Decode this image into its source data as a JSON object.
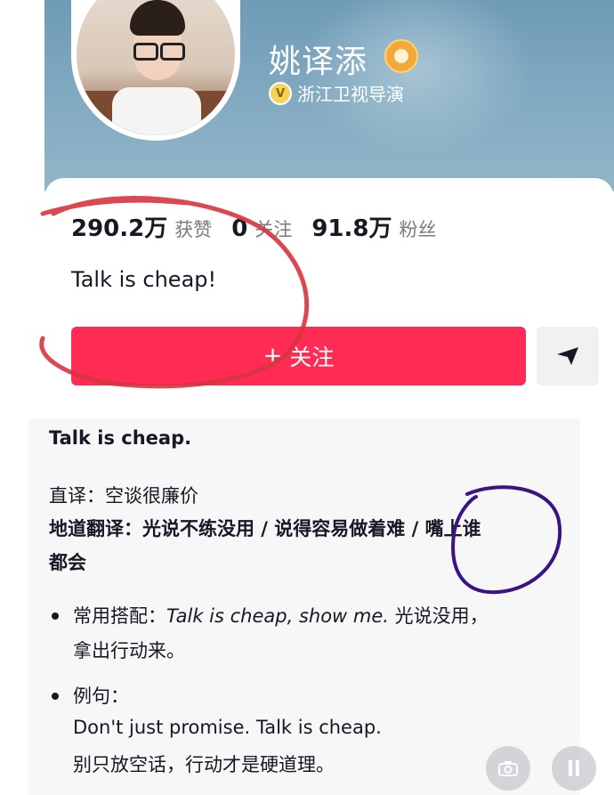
{
  "profile": {
    "name": "姚译添",
    "verified_label": "浙江卫视导演",
    "bio": "Talk is cheap!"
  },
  "stats": [
    {
      "value": "290.2万",
      "label": "获赞"
    },
    {
      "value": "0",
      "label": "关注"
    },
    {
      "value": "91.8万",
      "label": "粉丝"
    }
  ],
  "actions": {
    "follow_plus": "+",
    "follow_label": "关注"
  },
  "explanation": {
    "title": "Talk is cheap.",
    "literal_label": "直译：",
    "literal_value": "空谈很廉价",
    "idiomatic_label": "地道翻译：",
    "idiomatic_value_line1": "光说不练没用 / 说得容易做着难 / 嘴上谁",
    "idiomatic_value_line2": "都会",
    "collocation_label": "常用搭配：",
    "collocation_en": "Talk is cheap, show me.",
    "collocation_cn_1": "光说没用，",
    "collocation_cn_2": "拿出行动来。",
    "example_label": "例句：",
    "example_en": "Don't just promise. Talk is cheap.",
    "example_cn": "别只放空话，行动才是硬道理。"
  },
  "icons": {
    "lion": "lion-badge-icon",
    "verify": "verified-v-icon",
    "share": "share-arrow-icon",
    "camera": "camera-icon",
    "pause": "pause-icon"
  },
  "colors": {
    "accent": "#fe2c55",
    "banner": "#7fa8c0",
    "red_annotation": "#d7343f",
    "purple_annotation": "#3a1480"
  }
}
